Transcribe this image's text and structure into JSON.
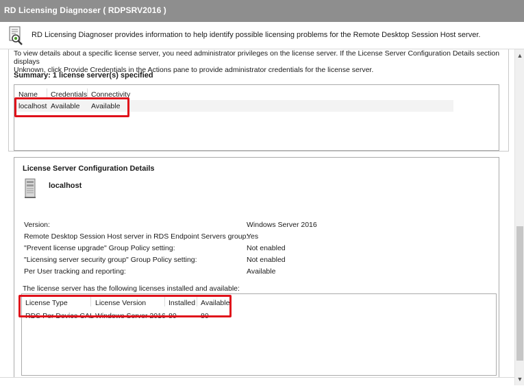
{
  "window": {
    "title": "RD Licensing Diagnoser ( RDPSRV2016 )"
  },
  "infobar": {
    "text": "RD Licensing Diagnoser provides information to help identify possible licensing problems for the Remote Desktop Session Host server."
  },
  "intro": {
    "line1": "To view details about a specific license server, you need administrator privileges on the license server. If the License Server Configuration Details section displays",
    "line2": "Unknown, click Provide Credentials in the Actions pane to provide administrator credentials for the license server."
  },
  "summary": "Summary: 1 license server(s) specified",
  "server_list": {
    "columns": [
      "Name",
      "Credentials",
      "Connectivity"
    ],
    "rows": [
      {
        "name": "localhost",
        "credentials": "Available",
        "connectivity": "Available"
      }
    ]
  },
  "details": {
    "title": "License Server Configuration Details",
    "server_name": "localhost",
    "properties": [
      {
        "label": "Version:",
        "value": "Windows Server 2016"
      },
      {
        "label": "Remote Desktop Session Host server in RDS Endpoint Servers group:",
        "value": "Yes"
      },
      {
        "label": "\"Prevent license upgrade\" Group Policy setting:",
        "value": "Not enabled"
      },
      {
        "label": "\"Licensing server security group\" Group Policy setting:",
        "value": "Not enabled"
      },
      {
        "label": "Per User tracking and reporting:",
        "value": "Available"
      }
    ],
    "licenses_caption": "The license server has the following licenses installed and available:",
    "license_columns": [
      "License Type",
      "License Version",
      "Installed",
      "Available"
    ],
    "licenses": [
      {
        "type": "RDS Per Device CAL",
        "version": "Windows Server 2016",
        "installed": "80",
        "available": "80"
      }
    ]
  },
  "colors": {
    "titlebar": "#8e8e8e",
    "highlight": "#e0101a"
  },
  "icons": {
    "app": "licensing-diagnoser-icon",
    "server": "server-tower-icon",
    "scroll_up": "chevron-up-icon",
    "scroll_down": "chevron-down-icon"
  }
}
